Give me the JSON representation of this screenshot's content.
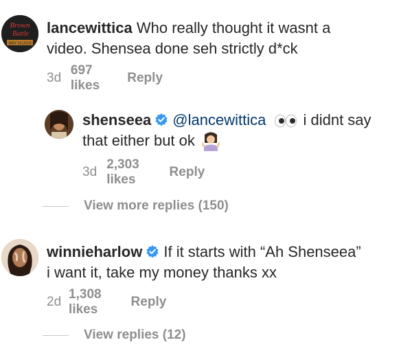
{
  "comments": [
    {
      "username": "lancewittica",
      "text": "Who really thought it wasnt a video. Shensea done seh strictly d*ck",
      "text_line2": "video. Shensea done seh strictly d*ck",
      "text_line1": "Who really thought it wasnt a",
      "age": "3d",
      "likes": "697 likes",
      "reply_label": "Reply",
      "avatar_text_top": "Brown",
      "avatar_text_mid": "Battle",
      "avatar_text_bottom": "MAY 24,2019"
    },
    {
      "username": "shenseea",
      "mention": "@lancewittica",
      "text_after": "i didnt say",
      "text_line2": "that either but ok",
      "age": "3d",
      "likes": "2,303 likes",
      "reply_label": "Reply"
    },
    {
      "username": "winnieharlow",
      "text_line1": "If it starts with “Ah Shenseea”",
      "text_line2": "i want it, take my money thanks xx",
      "age": "2d",
      "likes": "1,308 likes",
      "reply_label": "Reply"
    }
  ],
  "view_more_replies": "View more replies (150)",
  "view_replies": "View replies (12)",
  "icons": {
    "verified": "verified-badge-icon",
    "eyes": "eyes-emoji",
    "shrug": "woman-shrugging-emoji"
  },
  "colors": {
    "text": "#262626",
    "meta": "#8e8e8e",
    "verified": "#3897f0",
    "mention": "#00376b"
  }
}
